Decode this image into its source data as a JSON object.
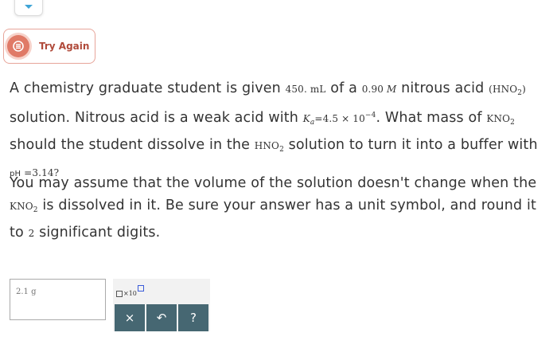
{
  "try_again": {
    "label": "Try Again"
  },
  "question": {
    "p1": {
      "t1": "A chemistry graduate student is given ",
      "volume": "450. mL",
      "t2": " of a ",
      "conc_num": "0.90",
      "conc_unit": "M",
      "t3": " nitrous acid ",
      "paren_open": "(",
      "acid_base": "HNO",
      "acid_sub": "2",
      "paren_close": ")",
      "t4": " solution. Nitrous acid is a weak acid with ",
      "ka_k": "K",
      "ka_sub": "a",
      "ka_val": "=4.5 × 10",
      "ka_exp": "−4",
      "t5": ". What mass of ",
      "salt_base": "KNO",
      "salt_sub": "2",
      "t6": " should the student dissolve in the ",
      "acid2_base": "HNO",
      "acid2_sub": "2",
      "t7": " solution to turn it into a buffer with ",
      "ph_label": "pH",
      "ph_val": " =3.14?"
    },
    "p2": {
      "t1": "You may assume that the volume of the solution doesn't change when the ",
      "salt_base": "KNO",
      "salt_sub": "2",
      "t2": " is dissolved in it. Be sure your answer has a unit symbol, and round it to ",
      "digits": "2",
      "t3": " significant digits."
    }
  },
  "answer": {
    "value": "2.1 g"
  },
  "keypad": {
    "x10_label": "×10",
    "clear": "×",
    "undo": "↶",
    "help": "?"
  },
  "colors": {
    "try_again_accent": "#e07a67",
    "keypad_button": "#466772",
    "x10_exponent_box": "#3a5bd9"
  }
}
